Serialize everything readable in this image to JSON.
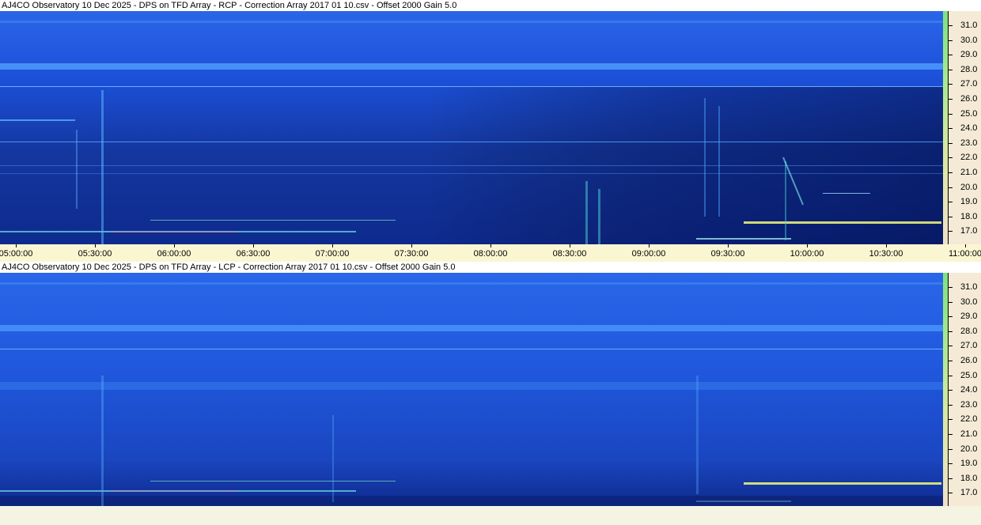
{
  "panels": [
    {
      "title": "AJ4CO Observatory 10 Dec 2025  -  DPS on TFD Array  -  RCP  -  Correction Array 2017 01 10.csv  -  Offset 2000  Gain 5.0",
      "polarization": "RCP"
    },
    {
      "title": "AJ4CO Observatory 10 Dec 2025  -  DPS on TFD Array  -  LCP  -  Correction Array 2017 01 10.csv  -  Offset 2000  Gain 5.0",
      "polarization": "LCP"
    }
  ],
  "frequency_labels": [
    "31.0",
    "30.0",
    "29.0",
    "28.0",
    "27.0",
    "26.0",
    "25.0",
    "24.0",
    "23.0",
    "22.0",
    "21.0",
    "20.0",
    "19.0",
    "18.0",
    "17.0"
  ],
  "time_labels": [
    "05:00:00",
    "05:30:00",
    "06:00:00",
    "06:30:00",
    "07:00:00",
    "07:30:00",
    "08:00:00",
    "08:30:00",
    "09:00:00",
    "09:30:00",
    "10:00:00",
    "10:30:00",
    "11:00:00"
  ],
  "colors": {
    "spectrogram_base": "#1a4fd6",
    "spectrogram_dark": "#0b2a9a",
    "scale_bg": "#f4ead6",
    "axis_bg": "#fbf6d2"
  }
}
